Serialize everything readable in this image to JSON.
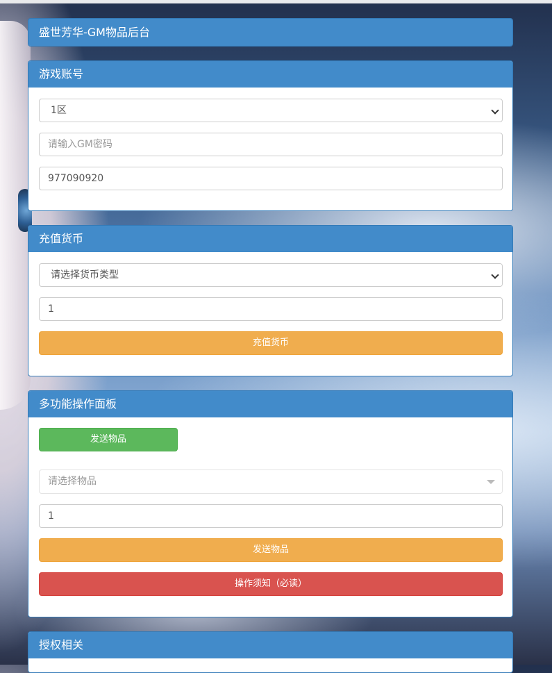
{
  "header": {
    "title": "盛世芳华-GM物品后台"
  },
  "account": {
    "title": "游戏账号",
    "server_selected": "1区",
    "password_placeholder": "请输入GM密码",
    "account_value": "977090920"
  },
  "recharge": {
    "title": "充值货币",
    "currency_selected": "请选择货币类型",
    "amount_value": "1",
    "submit_label": "充值货币"
  },
  "multi": {
    "title": "多功能操作面板",
    "tab_send_label": "发送物品",
    "item_placeholder": "请选择物品",
    "quantity_value": "1",
    "send_label": "发送物品",
    "notice_label": "操作须知（必读）"
  },
  "auth": {
    "title": "授权相关"
  },
  "colors": {
    "panel_header": "#428bca",
    "warning": "#f0ad4e",
    "danger": "#d9534f",
    "success": "#5cb85c"
  }
}
